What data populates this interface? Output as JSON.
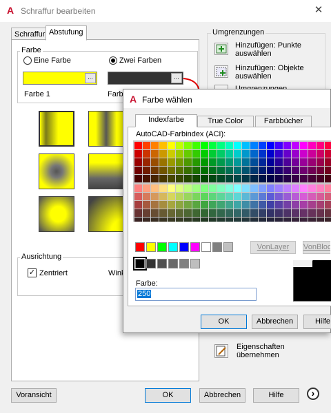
{
  "main": {
    "title": "Schraffur bearbeiten",
    "tabs": [
      "Schraffur",
      "Abstufung"
    ],
    "farbe": {
      "legend": "Farbe",
      "option_one": "Eine Farbe",
      "option_two": "Zwei Farben",
      "selected": "Zwei Farben",
      "color1_label": "Farbe 1",
      "color2_label": "Farbe",
      "color1_hex": "#ffff00",
      "color2_hex": "#333333",
      "ellipsis": "..."
    },
    "ausrichtung": {
      "legend": "Ausrichtung",
      "zentriert_label": "Zentriert",
      "zentriert_checked": true,
      "winkel_label": "Wink"
    },
    "umgrenzungen": {
      "heading": "Umgrenzungen",
      "points_label_1": "Hinzufügen: Punkte",
      "points_label_2": "auswählen",
      "objects_label_1": "Hinzufügen: Objekte",
      "objects_label_2": "auswählen",
      "clipped_label": "Umgrenzungen",
      "match_label_1": "Eigenschaften",
      "match_label_2": "übernehmen"
    },
    "buttons": {
      "preview": "Voransicht",
      "ok": "OK",
      "cancel": "Abbrechen",
      "help": "Hilfe",
      "expand": "›"
    }
  },
  "dialog": {
    "title": "Farbe wählen",
    "tabs": [
      "Indexfarbe",
      "True Color",
      "Farbbücher"
    ],
    "aci_label": "AutoCAD-Farbindex (ACI):",
    "bylayer": "VonLayer",
    "byblock": "VonBlock",
    "color_label": "Farbe:",
    "color_value": "250",
    "buttons": {
      "ok": "OK",
      "cancel": "Abbrechen",
      "help": "Hilfe"
    },
    "standard_colors": [
      "#ff0000",
      "#ffff00",
      "#00ff00",
      "#00ffff",
      "#0000ff",
      "#ff00ff",
      "#ffffff",
      "#808080",
      "#c0c0c0"
    ],
    "gray_shades": [
      "#000000",
      "#333333",
      "#505050",
      "#696969",
      "#808080",
      "#bebebe"
    ],
    "selected_hex": "#000000"
  },
  "colors": {
    "accent": "#0078d7",
    "logo": "#c8102e",
    "arrow": "#e00000"
  }
}
